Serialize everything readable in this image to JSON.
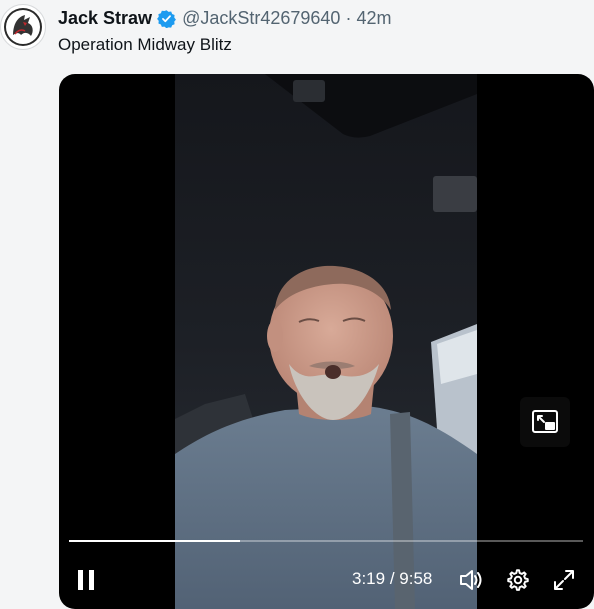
{
  "post": {
    "author": {
      "display_name": "Jack Straw",
      "handle": "@JackStr42679640",
      "separator": "·",
      "timestamp": "42m",
      "avatar_icon": "wolf-avatar-icon",
      "verified_icon": "verified-badge-icon"
    },
    "text": "Operation Midway Blitz"
  },
  "video": {
    "current_time": "3:19",
    "separator": "/",
    "duration": "9:58",
    "progress": 0.333,
    "state": "playing",
    "controls": {
      "play_pause_icon": "pause-icon",
      "volume_icon": "volume-icon",
      "settings_icon": "gear-icon",
      "fullscreen_icon": "expand-icon",
      "pip_icon": "picture-in-picture-icon"
    }
  },
  "colors": {
    "verified_blue": "#1d9bf0",
    "text_primary": "#0f1419",
    "text_secondary": "#536471",
    "video_bg": "#000000"
  }
}
